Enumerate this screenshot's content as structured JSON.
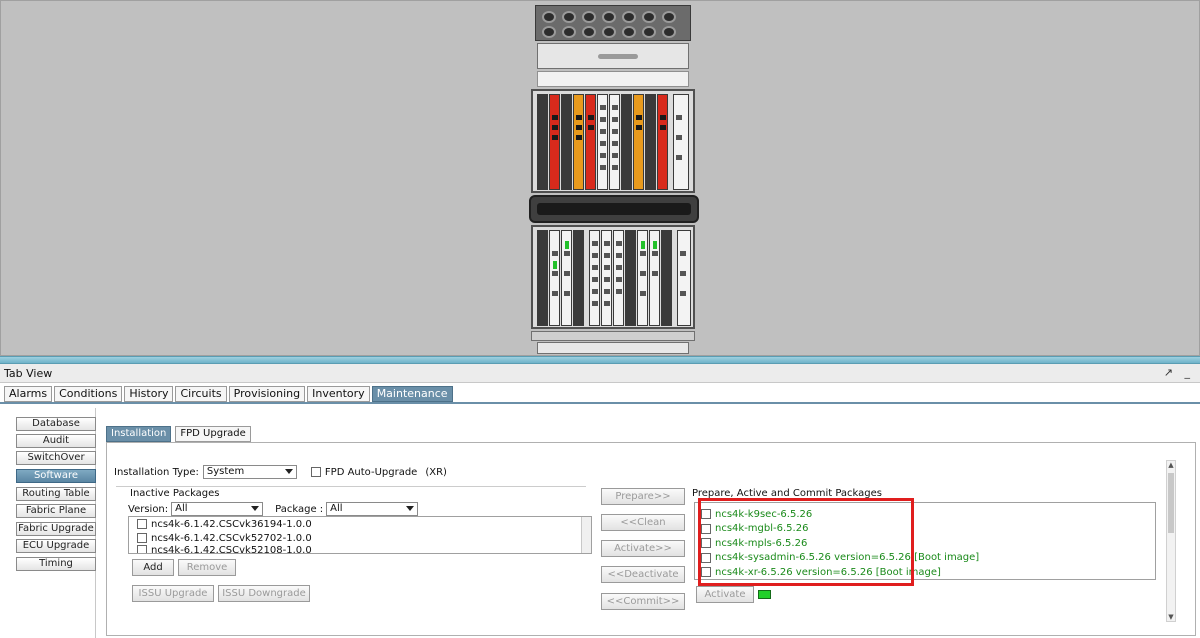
{
  "tab_view": {
    "title": "Tab View",
    "controls": "↗ _"
  },
  "main_tabs": [
    {
      "label": "Alarms",
      "active": false
    },
    {
      "label": "Conditions",
      "active": false
    },
    {
      "label": "History",
      "active": false
    },
    {
      "label": "Circuits",
      "active": false
    },
    {
      "label": "Provisioning",
      "active": false
    },
    {
      "label": "Inventory",
      "active": false
    },
    {
      "label": "Maintenance",
      "active": true
    }
  ],
  "left_nav": [
    {
      "label": "Database",
      "active": false
    },
    {
      "label": "Audit",
      "active": false
    },
    {
      "label": "SwitchOver",
      "active": false
    },
    {
      "label": "Software",
      "active": true
    },
    {
      "label": "Routing Table",
      "active": false
    },
    {
      "label": "Fabric Plane",
      "active": false
    },
    {
      "label": "Fabric Upgrade",
      "active": false
    },
    {
      "label": "ECU Upgrade",
      "active": false
    },
    {
      "label": "Timing",
      "active": false
    }
  ],
  "sub_tabs": [
    {
      "label": "Installation",
      "active": true
    },
    {
      "label": "FPD Upgrade",
      "active": false
    }
  ],
  "installation": {
    "type_label": "Installation Type:",
    "type_value": "System",
    "fpd_auto_upgrade_label": "FPD Auto-Upgrade",
    "fpd_auto_upgrade_suffix": "(XR)",
    "fpd_auto_upgrade_checked": false
  },
  "inactive_packages": {
    "title": "Inactive Packages",
    "version_label": "Version:",
    "version_value": "All",
    "package_label": "Package :",
    "package_value": "All",
    "items": [
      "ncs4k-6.1.42.CSCvk36194-1.0.0",
      "ncs4k-6.1.42.CSCvk52702-1.0.0",
      "ncs4k-6.1.42.CSCvk52108-1.0.0"
    ],
    "add_label": "Add",
    "remove_label": "Remove",
    "issu_upgrade_label": "ISSU Upgrade",
    "issu_downgrade_label": "ISSU Downgrade"
  },
  "middle_buttons": {
    "prepare": "Prepare>>",
    "clean": "<<Clean",
    "activate": "Activate>>",
    "deactivate": "<<Deactivate",
    "commit": "<<Commit>>"
  },
  "prepared_packages": {
    "title": "Prepare, Active and Commit Packages",
    "items": [
      "ncs4k-k9sec-6.5.26",
      "ncs4k-mgbl-6.5.26",
      "ncs4k-mpls-6.5.26",
      "ncs4k-sysadmin-6.5.26 version=6.5.26 [Boot image]",
      "ncs4k-xr-6.5.26 version=6.5.26 [Boot image]"
    ],
    "activate_label": "Activate",
    "item_color": "#1a8a1a",
    "status_led_color": "#22d02a",
    "highlight_color": "#e01e1e"
  }
}
